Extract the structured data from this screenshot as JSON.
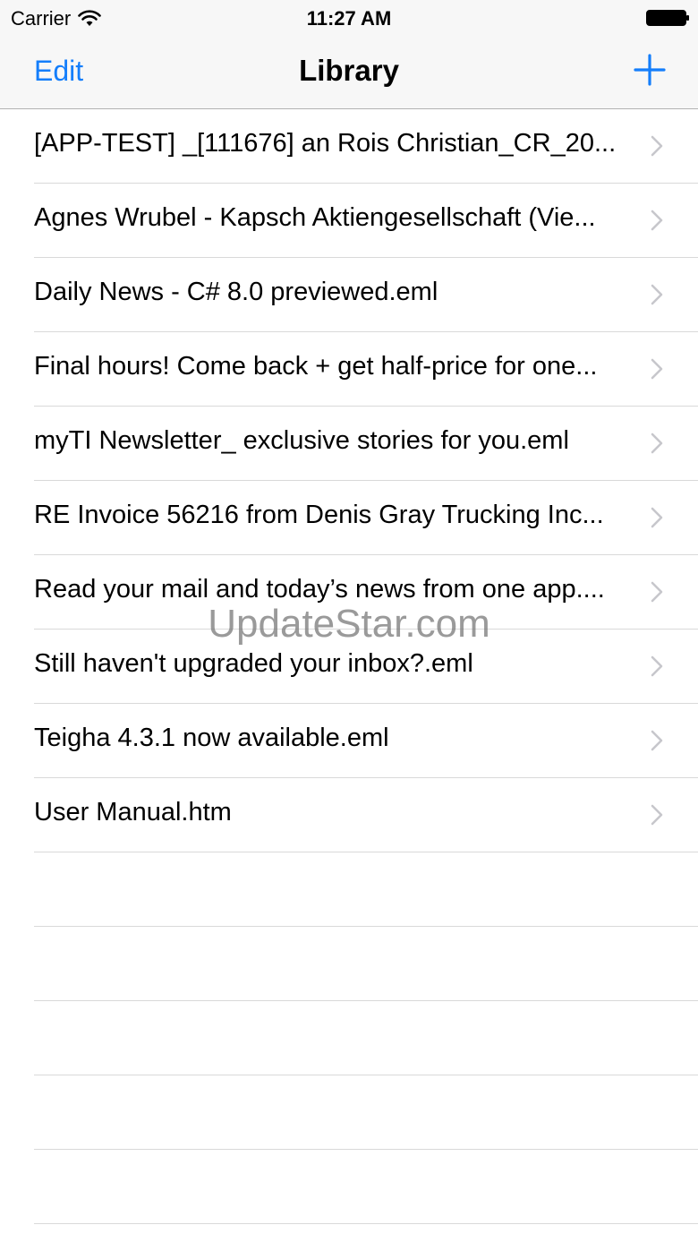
{
  "status_bar": {
    "carrier": "Carrier",
    "time": "11:27 AM"
  },
  "nav": {
    "edit_label": "Edit",
    "title": "Library",
    "add_icon": "plus-icon"
  },
  "colors": {
    "accent": "#147efb",
    "separator": "#d9d9d9",
    "chevron": "#c7c7cc"
  },
  "items": [
    {
      "label": "[APP-TEST] _[111676] an Rois Christian_CR_20..."
    },
    {
      "label": "Agnes Wrubel - Kapsch Aktiengesellschaft (Vie..."
    },
    {
      "label": "Daily News - C# 8.0 previewed.eml"
    },
    {
      "label": "Final hours! Come back + get half-price for one..."
    },
    {
      "label": "myTI Newsletter_ exclusive stories for you.eml"
    },
    {
      "label": "RE  Invoice 56216 from Denis Gray Trucking Inc..."
    },
    {
      "label": "Read your mail and today’s news from one app...."
    },
    {
      "label": "Still haven't upgraded your inbox?.eml"
    },
    {
      "label": "Teigha 4.3.1 now available.eml"
    },
    {
      "label": "User Manual.htm"
    }
  ],
  "watermark": "UpdateStar.com"
}
